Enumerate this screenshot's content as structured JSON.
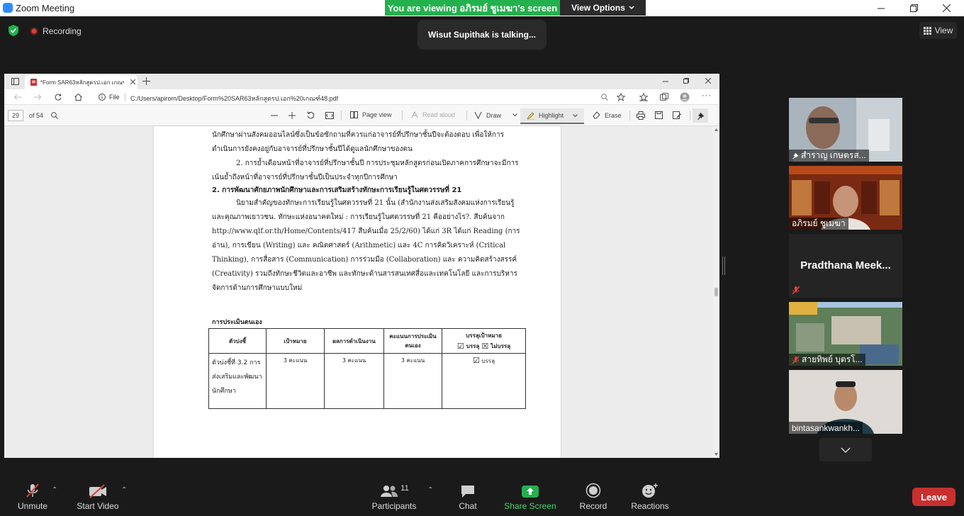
{
  "window": {
    "title": "Zoom Meeting"
  },
  "banner": {
    "viewing": "You are viewing อภิรมย์ ชูเมฆา's screen",
    "view_options": "View Options"
  },
  "talking": "Wisut Supithak is talking...",
  "recording": "Recording",
  "view_button": "View",
  "browser": {
    "tab_title": "*Form SAR63หลักสูตรป.เอก เกณฑ์48.pdf",
    "address_label": "File",
    "url": "C:/Users/apirom/Desktop/Form%20SAR63หลักสูตรป.เอก%20เกณฑ์48.pdf",
    "page_number": "29",
    "page_total": "of 54",
    "page_view": "Page view",
    "read_aloud": "Read aloud",
    "draw": "Draw",
    "highlight": "Highlight",
    "erase": "Erase"
  },
  "document": {
    "p1": "นักศึกษาผ่านสังคมออนไลน์ซึ่งเป็นข้อซักถามที่ควรแก่อาจารย์ที่ปรึกษาชั้นปีจะต้องตอบ เพื่อให้การดำเนินการยังคงอยู่กับอาจารย์ที่ปรึกษาชั้นปีได้ดูแลนักศึกษาของตน",
    "p2": "2. การย้ำเตือนหน้าที่อาจารย์ที่ปรึกษาชั้นปี การประชุมหลักสูตรก่อนเปิดภาคการศึกษาจะมีการเน้นย้ำถึงหน้าที่อาจารย์ที่ปรึกษาชั้นปีเป็นประจำทุกปีการศึกษา",
    "heading": "2. การพัฒนาศักยภาพนักศึกษาและการเสริมสร้างทักษะการเรียนรู้ในศตวรรษที่ 21",
    "p3": "นิยามสำคัญของทักษะการเรียนรู้ในศตวรรษที่ 21 นั้น (สำนักงานส่งเสริมสังคมแห่งการเรียนรู้และคุณภาพเยาวชน. ทักษะแห่งอนาคตใหม่ : การเรียนรู้ในศตวรรษที่ 21 คืออย่างไร?. สืบค้นจาก http://www.qlf.or.th/Home/Contents/417 สืบค้นเมื่อ 25/2/60) ได้แก่ 3R ได้แก่ Reading (การอ่าน), การเขียน (Writing) และ คณิตศาสตร์ (Arithmetic) และ 4C การคิดวิเคราะห์ (Critical Thinking), การสื่อสาร (Communication) การร่วมมือ (Collaboration) และ ความคิดสร้างสรรค์ (Creativity) รวมถึงทักษะชีวิตและอาชีพ และทักษะด้านสารสนเทศสื่อและเทคโนโลยี และการบริหารจัดการด้านการศึกษาแบบใหม่",
    "assess_title": "การประเมินตนเอง",
    "table": {
      "headers": [
        "ตัวบ่งชี้",
        "เป้าหมาย",
        "ผลการดำเนินงาน",
        "คะแนนการประเมินตนเอง",
        "บรรลุเป้าหมาย"
      ],
      "legend_yes": "บรรลุ",
      "legend_no": "ไม่บรรลุ",
      "row": [
        "ตัวบ่งชี้ที่ 3.2 การส่งเสริมและพัฒนานักศึกษา",
        "3 คะแนน",
        "3 คะแนน",
        "3 คะแนน",
        "บรรลุ"
      ]
    }
  },
  "participants": [
    {
      "name": "สำราญ เกษตรส...",
      "pinned": true,
      "muted": false
    },
    {
      "name": "อภิรมย์ ชูเมฆา",
      "pinned": false,
      "muted": false
    },
    {
      "name": "Pradthana Meek...",
      "pinned": false,
      "muted": true
    },
    {
      "name": "สายทิพย์ บุตรโ...",
      "pinned": false,
      "muted": true
    },
    {
      "name": "bintasankwankh...",
      "pinned": false,
      "muted": false
    }
  ],
  "toolbar": {
    "unmute": "Unmute",
    "start_video": "Start Video",
    "participants": "Participants",
    "participant_count": "11",
    "chat": "Chat",
    "share_screen": "Share Screen",
    "record": "Record",
    "reactions": "Reactions",
    "leave": "Leave"
  },
  "colors": {
    "share_green": "#23b14d",
    "leave_red": "#c8302f",
    "mute_red": "#e0403a"
  }
}
